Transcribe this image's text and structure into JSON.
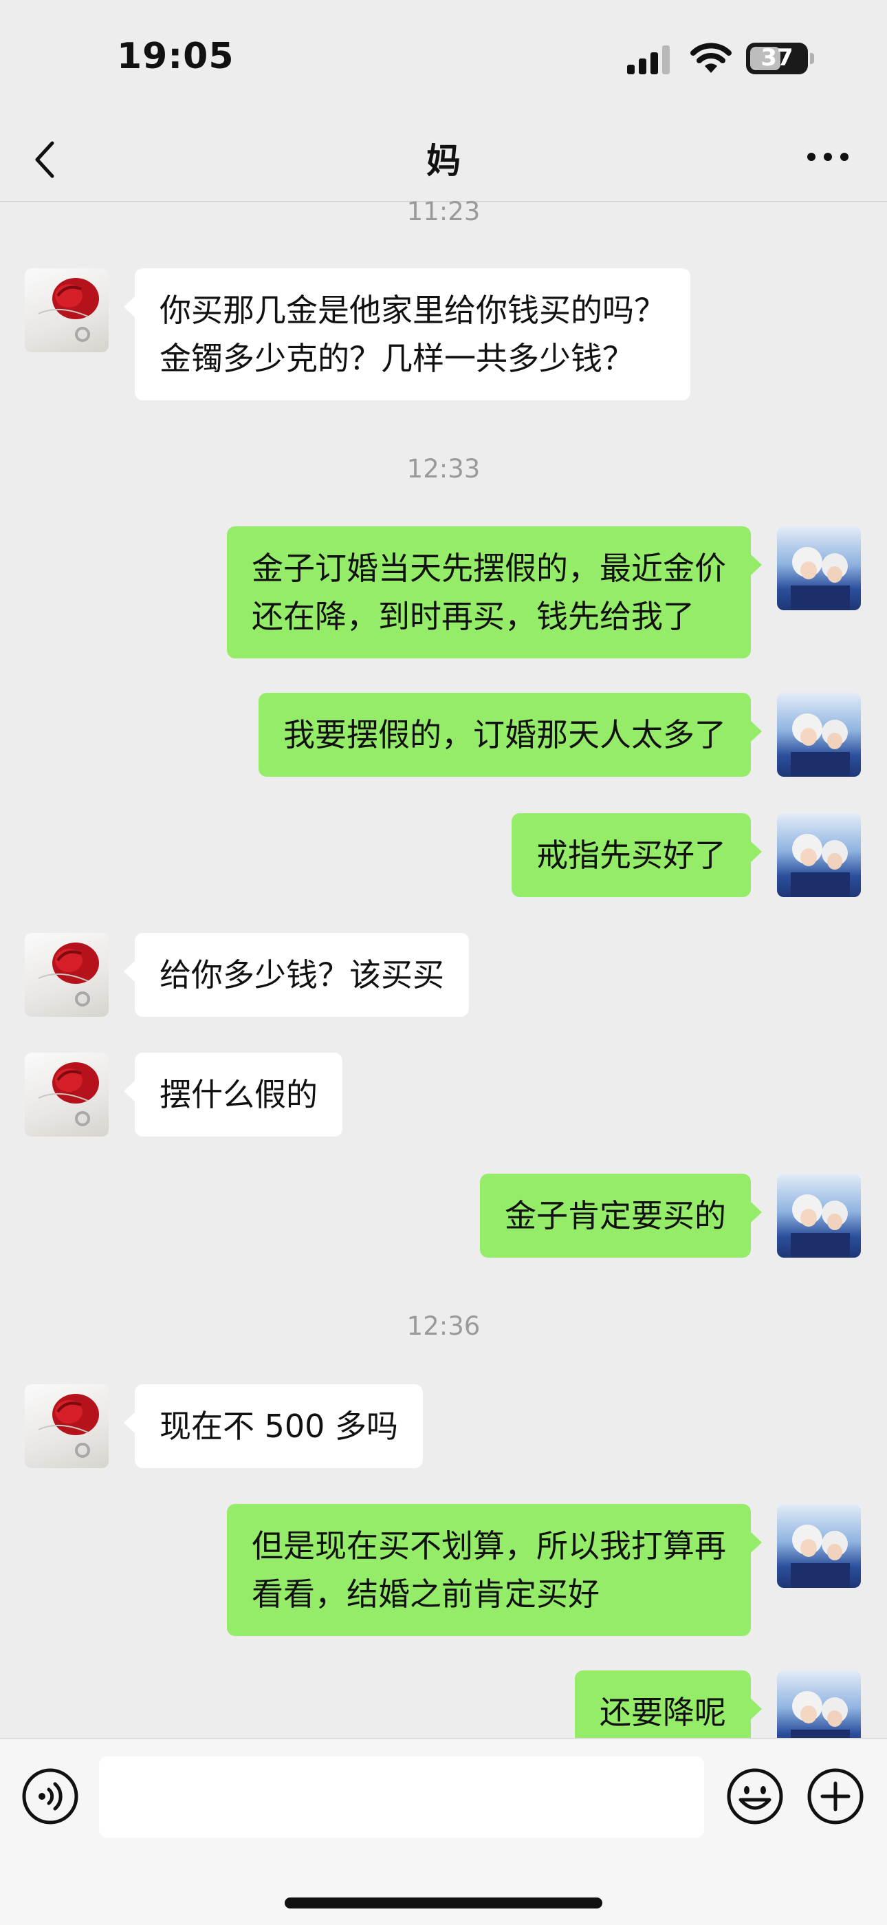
{
  "status_bar": {
    "time": "19:05",
    "battery_level": "37"
  },
  "header": {
    "title": "妈",
    "back_icon": "chevron-left-icon",
    "more_icon": "more-dots-icon"
  },
  "chat": {
    "timestamps": [
      "11:23",
      "12:33",
      "12:36"
    ],
    "messages": [
      {
        "sender": "mom",
        "text": "你买那几金是他家里给你钱买的吗？\n金镯多少克的？几样一共多少钱？"
      },
      {
        "sender": "me",
        "text": "金子订婚当天先摆假的，最近金价\n还在降，到时再买，钱先给我了"
      },
      {
        "sender": "me",
        "text": "我要摆假的，订婚那天人太多了"
      },
      {
        "sender": "me",
        "text": "戒指先买好了"
      },
      {
        "sender": "mom",
        "text": "给你多少钱？该买买"
      },
      {
        "sender": "mom",
        "text": "摆什么假的"
      },
      {
        "sender": "me",
        "text": "金子肯定要买的"
      },
      {
        "sender": "mom",
        "text": "现在不 500 多吗"
      },
      {
        "sender": "me",
        "text": "但是现在买不划算，所以我打算再\n看看，结婚之前肯定买好"
      },
      {
        "sender": "me",
        "text": "还要降呢"
      }
    ]
  },
  "input_bar": {
    "voice_icon": "voice-icon",
    "input_value": "",
    "emoji_icon": "emoji-icon",
    "add_icon": "plus-circle-icon"
  },
  "colors": {
    "background": "#ededed",
    "incoming_bubble": "#ffffff",
    "outgoing_bubble": "#95ec69",
    "timestamp": "#9a9a9a"
  }
}
